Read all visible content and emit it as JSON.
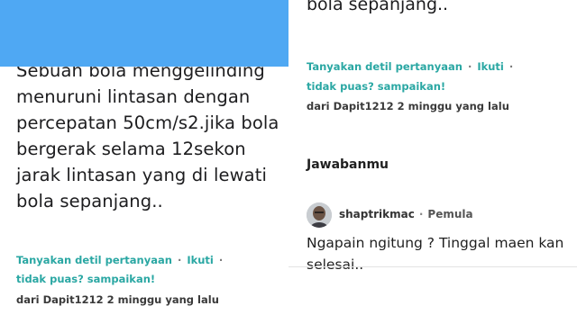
{
  "question": {
    "lines": [
      "Sebuah bola menggelinding",
      "menuruni lintasan dengan",
      "percepatan 50cm/s2.jika bola",
      "bergerak selama 12sekon",
      "jarak lintasan yang di lewati",
      "bola sepanjang.."
    ],
    "tail_text": "bola sepanjang.."
  },
  "actions": {
    "ask_detail": "Tanyakan detil pertanyaan",
    "follow": "Ikuti",
    "report": "tidak puas? sampaikan!",
    "separator": "·"
  },
  "meta": {
    "asked_by": "dari Dapit1212 2 minggu yang lalu"
  },
  "answers": {
    "title": "Jawabanmu",
    "answerer": {
      "username": "shaptrikmac",
      "rank": "Pemula"
    },
    "text_lines": [
      "Ngapain ngitung ? Tinggal maen kan",
      "selesai.."
    ]
  },
  "colors": {
    "accent": "#2aa7a3",
    "blue_block": "#4fa8f3"
  }
}
